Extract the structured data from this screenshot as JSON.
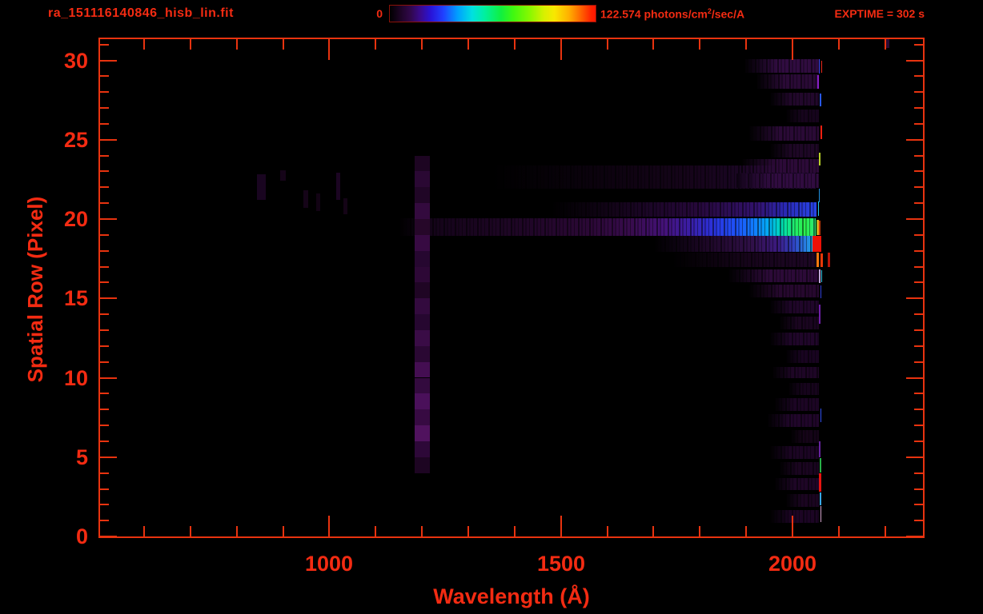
{
  "header": {
    "title": "ra_151116140846_hisb_lin.fit",
    "colorbar_min": "0",
    "colorbar_max_prefix": "122.574 photons/cm",
    "colorbar_max_sup": "2",
    "colorbar_max_suffix": "/sec/A",
    "exptime": "EXPTIME = 302 s"
  },
  "chart_data": {
    "type": "heatmap",
    "title": "ra_151116140846_hisb_lin.fit",
    "xlabel": "Wavelength (Å)",
    "ylabel": "Spatial Row (Pixel)",
    "x_axis": {
      "min": 505,
      "max": 2282,
      "unit": "angstrom",
      "major_ticks": [
        1000,
        1500,
        2000
      ],
      "minor_step": 100
    },
    "y_axis": {
      "min": 0,
      "max": 31.5,
      "unit": "pixel row",
      "major_ticks": [
        0,
        5,
        10,
        15,
        20,
        25,
        30
      ],
      "minor_step": 1
    },
    "colorbar": {
      "min": 0,
      "max": 122.574,
      "units": "photons/cm2/sec/A",
      "palette": [
        "#000000",
        "#30084a",
        "#2814d8",
        "#2040ff",
        "#00a0ff",
        "#00e0e0",
        "#10f040",
        "#88f800",
        "#f8e800",
        "#ffb000",
        "#ff7000",
        "#ff1800"
      ]
    },
    "exptime_s": 302,
    "features": {
      "bands": [
        {
          "name": "trace-row21",
          "r1": 20.15,
          "r2": 21.05,
          "l1": 1480,
          "l2": 2052,
          "stops": [
            [
              0,
              "rgba(0,0,0,0)"
            ],
            [
              0.25,
              "#14041a"
            ],
            [
              0.55,
              "#26083a"
            ],
            [
              0.78,
              "#32126e"
            ],
            [
              0.88,
              "#2a28b4"
            ],
            [
              1,
              "#2844e8"
            ]
          ]
        },
        {
          "name": "trace-main",
          "r1": 18.95,
          "r2": 20.05,
          "l1": 1150,
          "l2": 2050,
          "stops": [
            [
              0,
              "rgba(20,4,26,0)"
            ],
            [
              0.08,
              "#140419"
            ],
            [
              0.3,
              "#1f0626"
            ],
            [
              0.46,
              "#2b0836"
            ],
            [
              0.56,
              "#380c4e"
            ],
            [
              0.64,
              "#44127a"
            ],
            [
              0.7,
              "#3a1ea8"
            ],
            [
              0.755,
              "#2a32dc"
            ],
            [
              0.81,
              "#1e52f8"
            ],
            [
              0.855,
              "#1080ff"
            ],
            [
              0.89,
              "#00b0f0"
            ],
            [
              0.92,
              "#00dcb0"
            ],
            [
              0.95,
              "#20ee6a"
            ],
            [
              0.975,
              "#2cf04c"
            ],
            [
              1,
              "#28e87a"
            ]
          ]
        },
        {
          "name": "trace-row18",
          "r1": 17.95,
          "r2": 18.95,
          "l1": 1700,
          "l2": 2044,
          "stops": [
            [
              0,
              "rgba(0,0,0,0)"
            ],
            [
              0.35,
              "#1e0728"
            ],
            [
              0.62,
              "#301048"
            ],
            [
              0.78,
              "#3c1a80"
            ],
            [
              0.88,
              "#3040c0"
            ],
            [
              0.95,
              "#2878e0"
            ],
            [
              1,
              "#20a8e8"
            ]
          ]
        },
        {
          "name": "trace-row17",
          "r1": 17.0,
          "r2": 17.9,
          "l1": 1740,
          "l2": 2050,
          "stops": [
            [
              0,
              "rgba(0,0,0,0)"
            ],
            [
              0.5,
              "#150419"
            ],
            [
              1,
              "#1e0726"
            ]
          ]
        },
        {
          "name": "speckle-row22",
          "r1": 21.9,
          "r2": 23.4,
          "l1": 1350,
          "l2": 2050,
          "stops": [
            [
              0,
              "rgba(0,0,0,0)"
            ],
            [
              0.6,
              "#150419"
            ],
            [
              1,
              "#200830"
            ]
          ]
        }
      ],
      "noise_rows": [
        {
          "r1": 29.2,
          "r2": 30.1,
          "l1": 1895,
          "c": "#300c40"
        },
        {
          "r1": 28.2,
          "r2": 29.1,
          "l1": 1920,
          "c": "#2a0a36"
        },
        {
          "r1": 27.15,
          "r2": 27.95,
          "l1": 1950,
          "c": "#22082c"
        },
        {
          "r1": 26.1,
          "r2": 26.9,
          "l1": 1985,
          "c": "#16041c"
        },
        {
          "r1": 24.95,
          "r2": 25.85,
          "l1": 1905,
          "c": "#2a0a36"
        },
        {
          "r1": 23.9,
          "r2": 24.75,
          "l1": 1950,
          "c": "#1e0726"
        },
        {
          "r1": 22.9,
          "r2": 23.8,
          "l1": 1890,
          "c": "#2c0a38"
        },
        {
          "r1": 21.95,
          "r2": 22.85,
          "l1": 1880,
          "c": "#300c40"
        },
        {
          "r1": 16.0,
          "r2": 16.85,
          "l1": 1860,
          "c": "#2c0a38"
        },
        {
          "r1": 15.05,
          "r2": 15.85,
          "l1": 1905,
          "c": "#26082e"
        },
        {
          "r1": 14.05,
          "r2": 14.85,
          "l1": 1950,
          "c": "#20062a"
        },
        {
          "r1": 13.05,
          "r2": 13.85,
          "l1": 1970,
          "c": "#1a0520"
        },
        {
          "r1": 12.05,
          "r2": 12.85,
          "l1": 1950,
          "c": "#20062a"
        },
        {
          "r1": 10.95,
          "r2": 11.75,
          "l1": 1985,
          "c": "#180420"
        },
        {
          "r1": 9.95,
          "r2": 10.7,
          "l1": 1955,
          "c": "#1e0626"
        },
        {
          "r1": 8.9,
          "r2": 9.7,
          "l1": 1990,
          "c": "#16041c"
        },
        {
          "r1": 7.9,
          "r2": 8.7,
          "l1": 1960,
          "c": "#1c0524"
        },
        {
          "r1": 6.9,
          "r2": 7.7,
          "l1": 1945,
          "c": "#20062a"
        },
        {
          "r1": 5.9,
          "r2": 6.7,
          "l1": 1995,
          "c": "#150418"
        },
        {
          "r1": 4.9,
          "r2": 5.7,
          "l1": 1950,
          "c": "#1c0524"
        },
        {
          "r1": 3.9,
          "r2": 4.7,
          "l1": 1970,
          "c": "#1a0520"
        },
        {
          "r1": 2.9,
          "r2": 3.7,
          "l1": 1960,
          "c": "#1e0626"
        },
        {
          "r1": 1.85,
          "r2": 2.65,
          "l1": 1985,
          "c": "#1a0520"
        },
        {
          "r1": 0.85,
          "r2": 1.65,
          "l1": 1950,
          "c": "#1c0524"
        }
      ],
      "line_segments": [
        {
          "r1": 29.15,
          "r2": 30.1,
          "l1": 2057,
          "l2": 2060,
          "c": "#3848f0"
        },
        {
          "r1": 29.2,
          "r2": 30.0,
          "l1": 2062,
          "l2": 2065,
          "c": "#e82818"
        },
        {
          "r1": 28.2,
          "r2": 29.05,
          "l1": 2053,
          "l2": 2057,
          "c": "#8820c8"
        },
        {
          "r1": 27.1,
          "r2": 27.9,
          "l1": 2059,
          "l2": 2062,
          "c": "#2858f0"
        },
        {
          "r1": 25.05,
          "r2": 25.9,
          "l1": 2061,
          "l2": 2065,
          "c": "#f02010"
        },
        {
          "r1": 23.35,
          "r2": 24.2,
          "l1": 2058,
          "l2": 2061,
          "c": "#b8d028"
        },
        {
          "r1": 21.05,
          "r2": 21.9,
          "l1": 2057,
          "l2": 2059,
          "c": "#2090e0"
        },
        {
          "r1": 20.2,
          "r2": 21.1,
          "l1": 2055,
          "l2": 2058,
          "c": "#28c8e8"
        },
        {
          "r1": 18.98,
          "r2": 19.95,
          "l1": 2052,
          "l2": 2054,
          "c": "#58c828"
        },
        {
          "r1": 18.98,
          "r2": 19.95,
          "l1": 2054,
          "l2": 2058,
          "c": "#f0a018"
        },
        {
          "r1": 19.0,
          "r2": 19.9,
          "l1": 2058,
          "l2": 2061,
          "c": "#c03808"
        },
        {
          "r1": 17.95,
          "r2": 18.95,
          "l1": 2044,
          "l2": 2062,
          "c": "#ee1006"
        },
        {
          "r1": 17.0,
          "r2": 17.9,
          "l1": 2052,
          "l2": 2058,
          "c": "#ff7a10"
        },
        {
          "r1": 17.0,
          "r2": 17.85,
          "l1": 2060,
          "l2": 2066,
          "c": "#e83808"
        },
        {
          "r1": 17.0,
          "r2": 17.9,
          "l1": 2076,
          "l2": 2082,
          "c": "#b81408"
        },
        {
          "r1": 15.95,
          "r2": 16.85,
          "l1": 2058,
          "l2": 2061,
          "c": "#c0a8d8"
        },
        {
          "r1": 16.0,
          "r2": 16.8,
          "l1": 2062,
          "l2": 2064,
          "c": "#30c0e0"
        },
        {
          "r1": 15.0,
          "r2": 15.8,
          "l1": 2060,
          "l2": 2063,
          "c": "#3040d8"
        },
        {
          "r1": 13.4,
          "r2": 14.6,
          "l1": 2058,
          "l2": 2061,
          "c": "#7020a8"
        },
        {
          "r1": 7.2,
          "r2": 8.05,
          "l1": 2060,
          "l2": 2063,
          "c": "#3050f0"
        },
        {
          "r1": 5.0,
          "r2": 6.0,
          "l1": 2058,
          "l2": 2061,
          "c": "#6824a0"
        },
        {
          "r1": 4.05,
          "r2": 4.95,
          "l1": 2059,
          "l2": 2062,
          "c": "#28b048"
        },
        {
          "r1": 2.8,
          "r2": 4.0,
          "l1": 2058,
          "l2": 2062,
          "c": "#e81410"
        },
        {
          "r1": 1.95,
          "r2": 2.75,
          "l1": 2059,
          "l2": 2062,
          "c": "#38a8e8"
        },
        {
          "r1": 0.9,
          "r2": 1.9,
          "l1": 2061,
          "l2": 2063,
          "c": "#d0a0c8"
        }
      ],
      "smudges": [
        {
          "r1": 21.2,
          "r2": 22.8,
          "l1": 844,
          "l2": 863,
          "c": "#190520"
        },
        {
          "r1": 22.4,
          "r2": 23.1,
          "l1": 894,
          "l2": 906,
          "c": "#150418"
        },
        {
          "r1": 20.7,
          "r2": 21.8,
          "l1": 944,
          "l2": 955,
          "c": "#150418"
        },
        {
          "r1": 20.5,
          "r2": 21.6,
          "l1": 972,
          "l2": 980,
          "c": "#120314"
        },
        {
          "r1": 21.2,
          "r2": 22.9,
          "l1": 1015,
          "l2": 1024,
          "c": "#1b0522"
        },
        {
          "r1": 20.3,
          "r2": 21.3,
          "l1": 1030,
          "l2": 1039,
          "c": "#140416"
        },
        {
          "r1": 30.8,
          "r2": 31.5,
          "l1": 2202,
          "l2": 2210,
          "c": "#2a0a34"
        }
      ],
      "lyman_alpha": {
        "l1": 1185,
        "l2": 1218,
        "segments": [
          {
            "r1": 23.0,
            "r2": 24.0,
            "c": "#1d0522"
          },
          {
            "r1": 22.0,
            "r2": 23.0,
            "c": "#2a0833"
          },
          {
            "r1": 21.0,
            "r2": 22.0,
            "c": "#200626"
          },
          {
            "r1": 20.0,
            "r2": 21.0,
            "c": "#330a3e"
          },
          {
            "r1": 19.0,
            "r2": 20.0,
            "c": "#260729"
          },
          {
            "r1": 18.0,
            "r2": 19.0,
            "c": "#370a42"
          },
          {
            "r1": 17.0,
            "r2": 18.0,
            "c": "#260730"
          },
          {
            "r1": 16.0,
            "r2": 17.0,
            "c": "#2d0836"
          },
          {
            "r1": 15.0,
            "r2": 16.0,
            "c": "#1f0524"
          },
          {
            "r1": 14.0,
            "r2": 15.0,
            "c": "#330a3e"
          },
          {
            "r1": 13.0,
            "r2": 14.0,
            "c": "#260730"
          },
          {
            "r1": 12.0,
            "r2": 13.0,
            "c": "#3a0c46"
          },
          {
            "r1": 11.0,
            "r2": 12.0,
            "c": "#2a0833"
          },
          {
            "r1": 10.0,
            "r2": 11.0,
            "c": "#440e52"
          },
          {
            "r1": 9.0,
            "r2": 10.0,
            "c": "#330a3e"
          },
          {
            "r1": 8.0,
            "r2": 9.0,
            "c": "#4a105a"
          },
          {
            "r1": 7.0,
            "r2": 8.0,
            "c": "#370a42"
          },
          {
            "r1": 6.0,
            "r2": 7.0,
            "c": "#50125e"
          },
          {
            "r1": 5.0,
            "r2": 6.0,
            "c": "#2d0838"
          },
          {
            "r1": 4.0,
            "r2": 5.0,
            "c": "#1d0522"
          }
        ]
      }
    }
  }
}
